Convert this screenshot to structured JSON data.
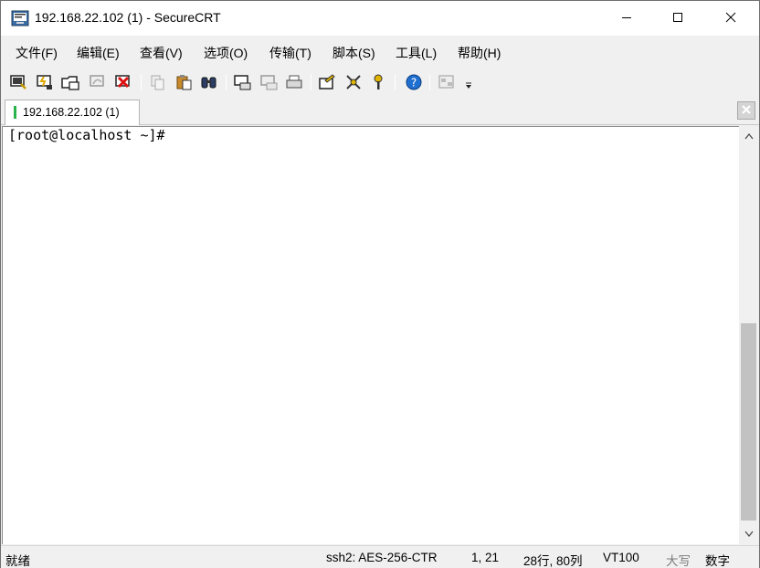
{
  "window": {
    "title": "192.168.22.102 (1) - SecureCRT",
    "controls": {
      "minimize": "minimize-icon",
      "maximize": "maximize-icon",
      "close": "close-icon"
    }
  },
  "menu": {
    "items": [
      {
        "label": "文件(F)"
      },
      {
        "label": "编辑(E)"
      },
      {
        "label": "查看(V)"
      },
      {
        "label": "选项(O)"
      },
      {
        "label": "传输(T)"
      },
      {
        "label": "脚本(S)"
      },
      {
        "label": "工具(L)"
      },
      {
        "label": "帮助(H)"
      }
    ]
  },
  "toolbar": {
    "icons": [
      "connect-icon",
      "quick-connect-icon",
      "connect-in-tab-icon",
      "reconnect-icon",
      "disconnect-icon",
      "copy-icon",
      "paste-icon",
      "find-icon",
      "print-screen-icon",
      "print-selection-icon",
      "print-icon",
      "session-options-icon",
      "keymap-icon",
      "key-agent-icon",
      "help-icon",
      "sftp-icon"
    ]
  },
  "tabs": [
    {
      "label": "192.168.22.102 (1)",
      "status_color": "#29b34a"
    }
  ],
  "terminal": {
    "lines": [
      "[root@localhost ~]#"
    ]
  },
  "statusbar": {
    "ready": "就绪",
    "cipher": "ssh2: AES-256-CTR",
    "cursor": "1,  21",
    "size": "28行, 80列",
    "emulation": "VT100",
    "caps": "大写",
    "num": "数字"
  },
  "colors": {
    "chrome": "#f0f0f0",
    "terminal_bg": "#ffffff",
    "tab_active_marker": "#29b34a",
    "help_blue": "#1f6fd1"
  }
}
